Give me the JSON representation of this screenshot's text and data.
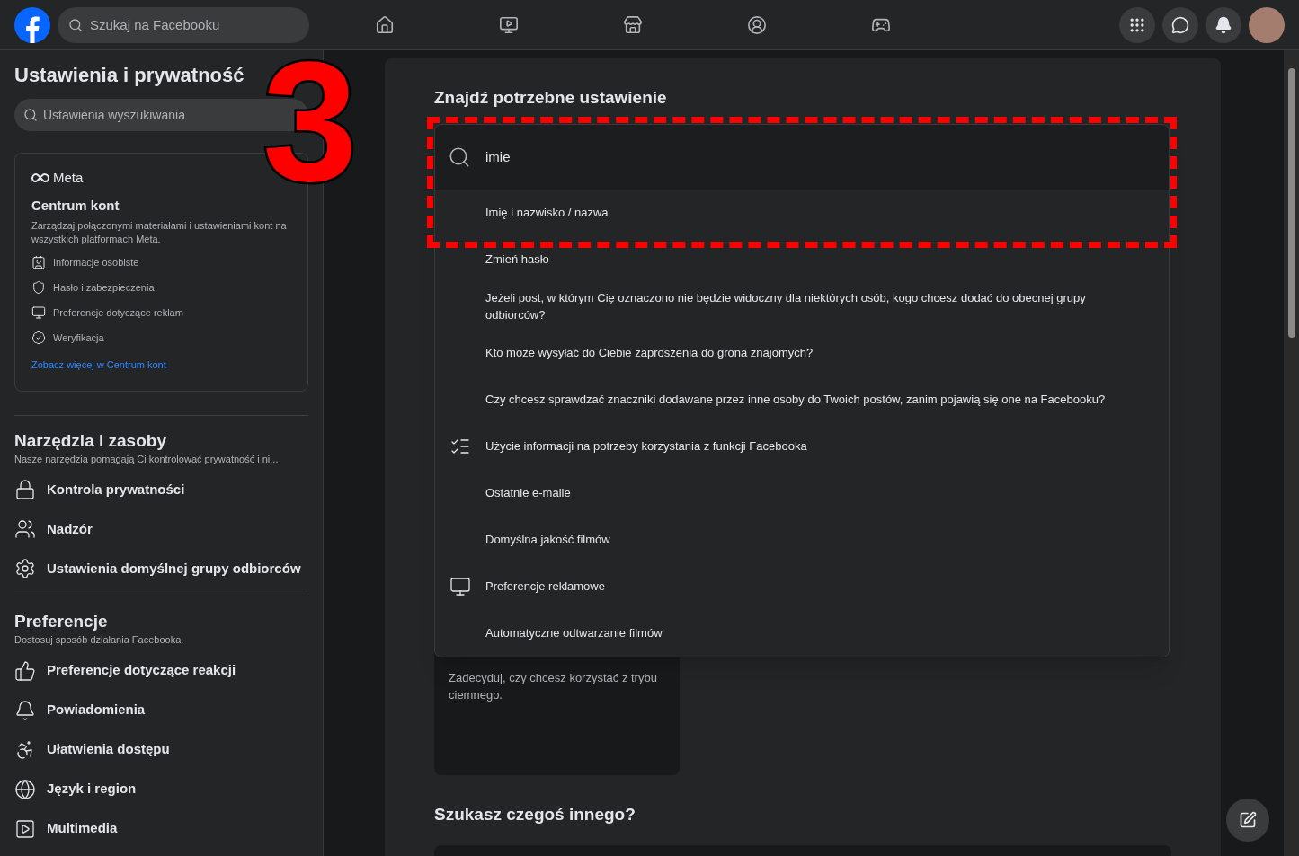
{
  "top_bar": {
    "search": {
      "placeholder": "Szukaj na Facebooku"
    }
  },
  "sidebar": {
    "title": "Ustawienia i prywatność",
    "search": {
      "placeholder": "Ustawienia wyszukiwania"
    },
    "accounts_center": {
      "brand": "Meta",
      "title": "Centrum kont",
      "description": "Zarządzaj połączonymi materiałami i ustawieniami kont na wszystkich platformach Meta.",
      "items": [
        "Informacje osobiste",
        "Hasło i zabezpieczenia",
        "Preferencje dotyczące reklam",
        "Weryfikacja"
      ],
      "link": "Zobacz więcej w Centrum kont"
    },
    "sections": [
      {
        "title": "Narzędzia i zasoby",
        "subtitle": "Nasze narzędzia pomagają Ci kontrolować prywatność i ni...",
        "items": [
          "Kontrola prywatności",
          "Nadzór",
          "Ustawienia domyślnej grupy odbiorców"
        ]
      },
      {
        "title": "Preferencje",
        "subtitle": "Dostosuj sposób działania Facebooka.",
        "items": [
          "Preferencje dotyczące reakcji",
          "Powiadomienia",
          "Ułatwienia dostępu",
          "Język i region",
          "Multimedia"
        ]
      }
    ]
  },
  "main": {
    "heading": "Znajdź potrzebne ustawienie",
    "search": {
      "value": "imie"
    },
    "results": [
      {
        "label": "Imię i nazwisko / nazwa",
        "kind": "plain"
      },
      {
        "label": "Zmień hasło",
        "kind": "plain"
      },
      {
        "label": "Jeżeli post, w którym Cię oznaczono nie będzie widoczny dla niektórych osób, kogo chcesz dodać do obecnej grupy odbiorców?",
        "kind": "plain"
      },
      {
        "label": "Kto może wysyłać do Ciebie zaproszenia do grona znajomych?",
        "kind": "plain"
      },
      {
        "label": "Czy chcesz sprawdzać znaczniki dodawane przez inne osoby do Twoich postów, zanim pojawią się one na Facebooku?",
        "kind": "plain"
      },
      {
        "label": "Użycie informacji na potrzeby korzystania z funkcji Facebooka",
        "kind": "checklist"
      },
      {
        "label": "Ostatnie e-maile",
        "kind": "plain"
      },
      {
        "label": "Domyślna jakość filmów",
        "kind": "plain"
      },
      {
        "label": "Preferencje reklamowe",
        "kind": "screen"
      },
      {
        "label": "Automatyczne odtwarzanie filmów",
        "kind": "plain"
      }
    ],
    "dark_mode_card": {
      "description": "Zadecyduj, czy chcesz korzystać z trybu ciemnego."
    },
    "other_heading": "Szukasz czegoś innego?"
  },
  "annotation": {
    "number": "3"
  }
}
